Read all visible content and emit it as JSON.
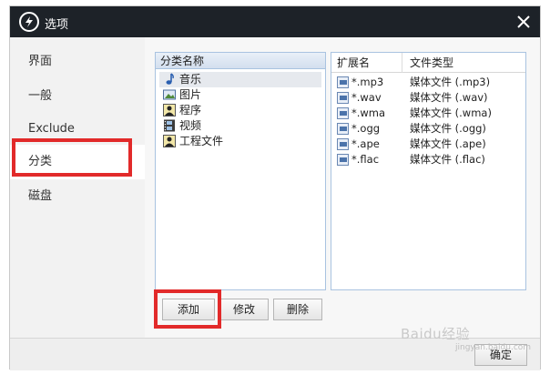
{
  "window": {
    "title": "选项"
  },
  "sidebar": {
    "items": [
      {
        "label": "界面"
      },
      {
        "label": "一般"
      },
      {
        "label": "Exclude"
      },
      {
        "label": "分类"
      },
      {
        "label": "磁盘"
      }
    ],
    "active_index": 3
  },
  "categories": {
    "header": "分类名称",
    "items": [
      {
        "label": "音乐",
        "icon": "music-note-icon"
      },
      {
        "label": "图片",
        "icon": "picture-icon"
      },
      {
        "label": "程序",
        "icon": "program-user-icon"
      },
      {
        "label": "视频",
        "icon": "film-icon"
      },
      {
        "label": "工程文件",
        "icon": "project-user-icon"
      }
    ],
    "selected_index": 0
  },
  "extensions": {
    "headers": {
      "ext": "扩展名",
      "type": "文件类型"
    },
    "rows": [
      {
        "ext": "*.mp3",
        "type": "媒体文件 (.mp3)"
      },
      {
        "ext": "*.wav",
        "type": "媒体文件 (.wav)"
      },
      {
        "ext": "*.wma",
        "type": "媒体文件 (.wma)"
      },
      {
        "ext": "*.ogg",
        "type": "媒体文件 (.ogg)"
      },
      {
        "ext": "*.ape",
        "type": "媒体文件 (.ape)"
      },
      {
        "ext": "*.flac",
        "type": "媒体文件 (.flac)"
      }
    ]
  },
  "buttons": {
    "add": "添加",
    "edit": "修改",
    "delete": "删除",
    "ok": "确定"
  },
  "watermark": {
    "text": "Baidu经验",
    "sub": "jingyan.baidu.com"
  },
  "colors": {
    "titlebar": "#1d2228",
    "highlight": "#e22a2a",
    "selection": "#e6e9ee"
  }
}
